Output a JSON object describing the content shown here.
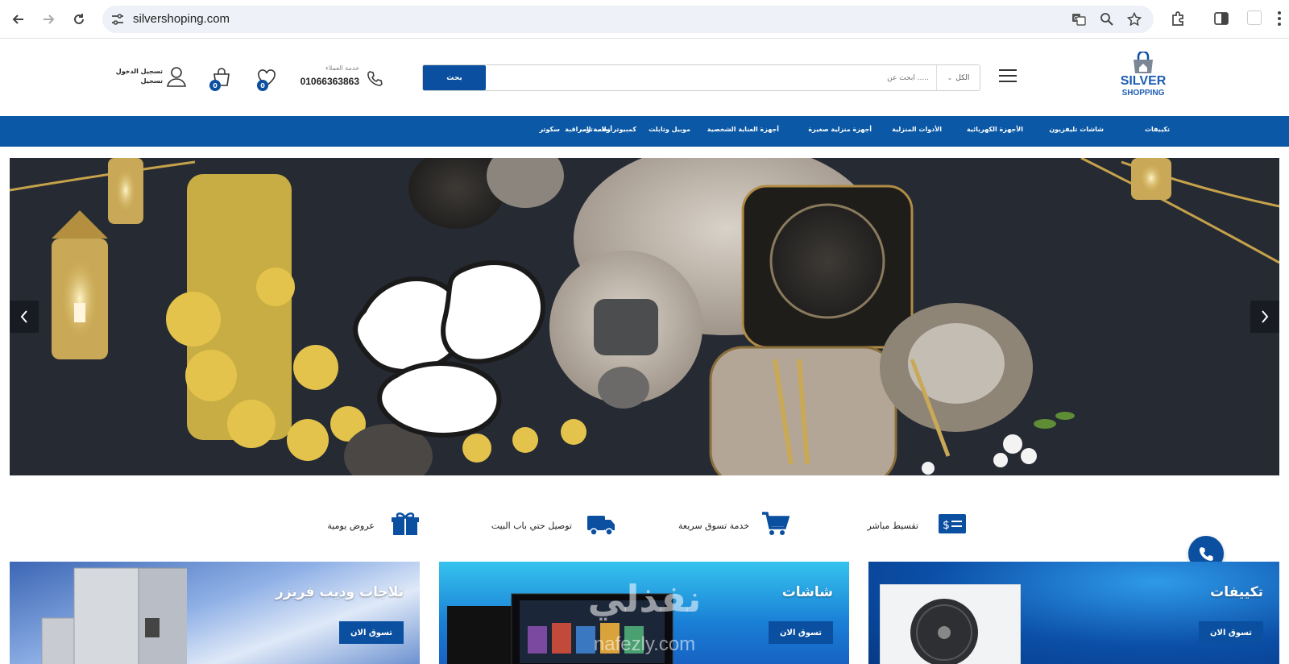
{
  "browser": {
    "url": "silvershoping.com"
  },
  "header": {
    "logo": {
      "line1": "SILVER",
      "line2": "SHOPPING"
    },
    "search": {
      "button_label": "بحث",
      "placeholder": "ابحث عن .....",
      "category_value": "الكل"
    },
    "contact": {
      "label": "خدمة العملاء",
      "phone": "01066363863"
    },
    "wishlist_count": "0",
    "cart_count": "0",
    "account": {
      "login_label": "تسجيل الدخول",
      "register_label": "تسجيل"
    }
  },
  "categories": [
    "تكييفات",
    "شاشات تليفزيون",
    "الأجهزة الكهربائية",
    "الأدوات المنزلية",
    "أجهزة منزلية صغيرة",
    "أجهزة العناية الشخصية",
    "موبيل وتابلت",
    "كمبيوتر ولاب توب",
    "أنظمة المراقبة",
    "سكوتر"
  ],
  "features": [
    {
      "label": "تقسيط مباشر",
      "icon": "money-card-icon"
    },
    {
      "label": "خدمة تسوق سريعة",
      "icon": "shopping-cart-icon"
    },
    {
      "label": "توصيل حتي باب البيت",
      "icon": "delivery-truck-icon"
    },
    {
      "label": "عروض يومية",
      "icon": "gift-icon"
    }
  ],
  "banners": [
    {
      "title": "تكييفات",
      "button": "تسوق الان"
    },
    {
      "title": "شاشات",
      "button": "تسوق الان"
    },
    {
      "title": "ثلاجات وديب فريزر",
      "button": "تسوق الان"
    }
  ],
  "watermark": {
    "arabic": "نفذلي",
    "latin": "nafezly.com"
  },
  "colors": {
    "brand_blue": "#0a58a6",
    "button_blue": "#0a4fa0"
  }
}
